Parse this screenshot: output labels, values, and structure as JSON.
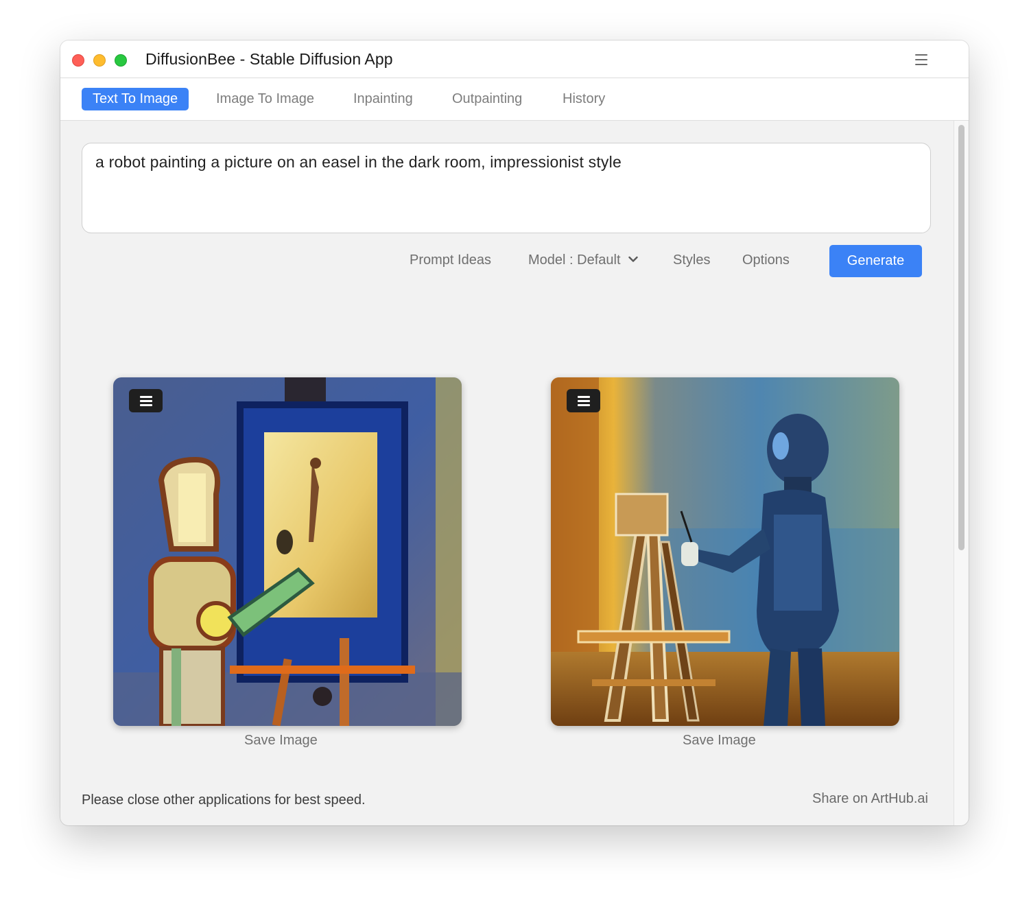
{
  "window": {
    "title": "DiffusionBee - Stable Diffusion App"
  },
  "tabs": [
    {
      "label": "Text To Image",
      "active": true
    },
    {
      "label": "Image To Image",
      "active": false
    },
    {
      "label": "Inpainting",
      "active": false
    },
    {
      "label": "Outpainting",
      "active": false
    },
    {
      "label": "History",
      "active": false
    }
  ],
  "prompt": {
    "value": "a robot painting a picture on an easel in the dark room, impressionist style"
  },
  "toolbar": {
    "prompt_ideas": "Prompt Ideas",
    "model": "Model : Default",
    "styles": "Styles",
    "options": "Options",
    "generate": "Generate"
  },
  "results": [
    {
      "save_label": "Save Image",
      "icon": "menu-icon"
    },
    {
      "save_label": "Save Image",
      "icon": "menu-icon"
    }
  ],
  "footer": {
    "status": "Please close other applications for best speed.",
    "share": "Share on ArtHub.ai"
  },
  "colors": {
    "accent": "#3b82f6",
    "close": "#fe5f57",
    "minimize": "#febc2e",
    "maximize": "#28c840"
  }
}
